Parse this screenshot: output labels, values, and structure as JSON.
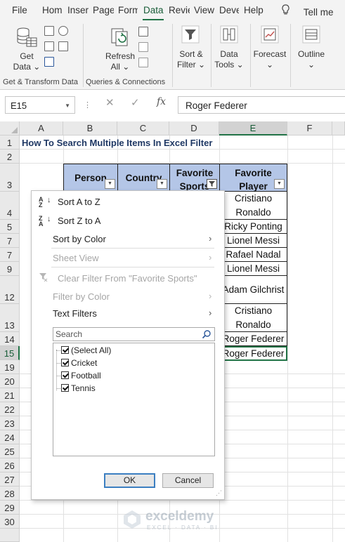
{
  "ribbon_tabs": [
    "File",
    "Hom",
    "Inser",
    "Page",
    "Form",
    "Data",
    "Revie",
    "View",
    "Deve",
    "Help"
  ],
  "active_tab": "Data",
  "tell_me": "Tell me",
  "ribbon": {
    "get_data": "Get Data ⌄",
    "get_data_line1": "Get",
    "get_data_line2": "Data ⌄",
    "refresh_line1": "Refresh",
    "refresh_line2": "All ⌄",
    "sort_filter_line1": "Sort &",
    "sort_filter_line2": "Filter ⌄",
    "data_tools_line1": "Data",
    "data_tools_line2": "Tools ⌄",
    "forecast_line1": "Forecast",
    "forecast_line2": "⌄",
    "outline_line1": "Outline",
    "outline_line2": "⌄",
    "group_get_transform": "Get & Transform Data",
    "group_queries": "Queries & Connections"
  },
  "formula_bar": {
    "name_box": "E15",
    "formula": "Roger Federer",
    "fx_label": "fx"
  },
  "columns": [
    "A",
    "B",
    "C",
    "D",
    "E",
    "F"
  ],
  "rows": [
    "1",
    "2",
    "3",
    "4",
    "5",
    "7",
    "9",
    "12",
    "13",
    "14",
    "15",
    "19",
    "20",
    "21",
    "22",
    "23",
    "24",
    "25",
    "26",
    "27",
    "28",
    "29",
    "30"
  ],
  "sheet": {
    "title": "How To Search Multiple Items In Excel Filter",
    "headers": {
      "person": "Person",
      "country": "Country",
      "sport_line1": "Favorite",
      "sport_line2": "Sports",
      "player_line1": "Favorite",
      "player_line2": "Player"
    },
    "favorite_players": [
      "Cristiano Ronaldo",
      "Ricky Ponting",
      "Lionel Messi",
      "Rafael Nadal",
      "Lionel Messi",
      "Adam Gilchrist",
      "Cristiano Ronaldo",
      "Roger Federer",
      "Roger Federer"
    ]
  },
  "filter_menu": {
    "sort_az": "Sort A to Z",
    "sort_za": "Sort Z to A",
    "sort_by_color": "Sort by Color",
    "sheet_view": "Sheet View",
    "clear_filter": "Clear Filter From \"Favorite Sports\"",
    "filter_by_color": "Filter by Color",
    "text_filters": "Text Filters",
    "search_placeholder": "Search",
    "items": [
      "(Select All)",
      "Cricket",
      "Football",
      "Tennis"
    ],
    "ok": "OK",
    "cancel": "Cancel"
  },
  "watermark": {
    "name": "exceldemy",
    "tagline": "EXCEL · DATA · BI"
  }
}
